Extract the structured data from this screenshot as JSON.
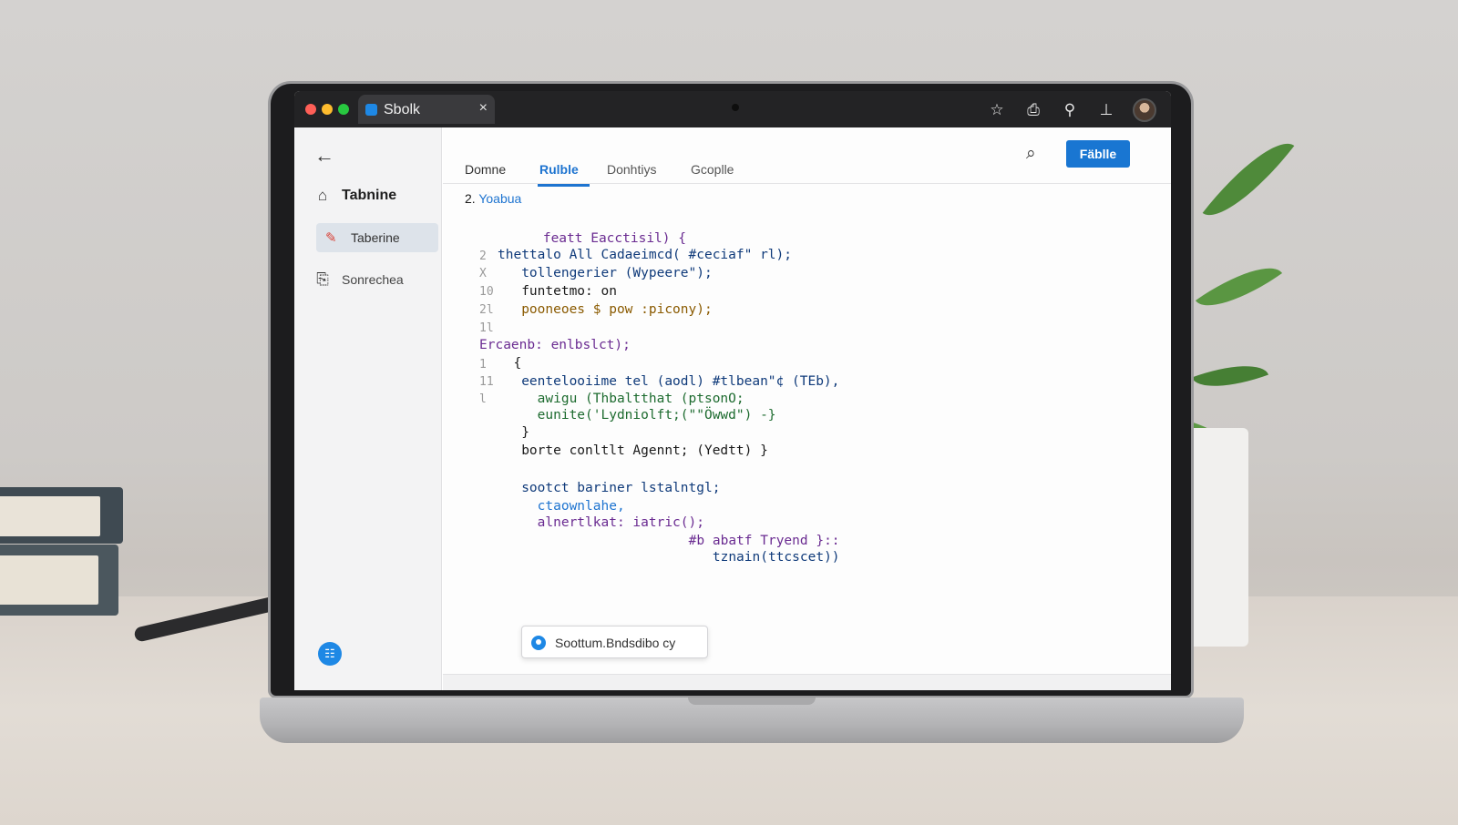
{
  "browser": {
    "tab_title": "Sbolk",
    "tab_close": "×"
  },
  "sidebar": {
    "back_icon": "←",
    "items": [
      {
        "label": "Tabnine",
        "icon": "home-icon"
      },
      {
        "label": "Taberine",
        "icon": "pencil-icon"
      },
      {
        "label": "Sonrechea",
        "icon": "export-icon"
      }
    ]
  },
  "main": {
    "tabs": [
      "Domne",
      "Rulble",
      "Donhtiys",
      "Gcoplle"
    ],
    "active_tab": "Rulble",
    "action_button": "Fäblle",
    "file_prefix": "2.",
    "file_name": "Yoabua"
  },
  "code": {
    "lines": [
      {
        "ln": "",
        "text": "featt Eacctisil) {"
      },
      {
        "ln": "2",
        "text": "thettalo All Cadaeimcd( #ceciaf\" rl);"
      },
      {
        "ln": "X",
        "text": "   tollengerier (Wypeere\");"
      },
      {
        "ln": "10",
        "text": "   funtetmo: on"
      },
      {
        "ln": "2l",
        "text": "   pooneoes $ pow :picony);"
      },
      {
        "ln": "1l",
        "text": ""
      },
      {
        "ln": "",
        "text": "Ercaenb: enlbslct);"
      },
      {
        "ln": "1",
        "text": "  {"
      },
      {
        "ln": "11",
        "text": "   eentelooiime tel (aodl) #tlbean\"¢ (TEb),"
      },
      {
        "ln": "l",
        "text": "     awigu (Thbaltthat (ptsonO;"
      },
      {
        "ln": "",
        "text": "     eunite('Lydniolft;(\"\"Öwwd\") -}"
      },
      {
        "ln": "",
        "text": "   }"
      },
      {
        "ln": "",
        "text": "   borte conltlt Agennt; (Yedtt) }"
      },
      {
        "ln": "",
        "text": ""
      },
      {
        "ln": "",
        "text": "   sootct bariner lstalntgl;"
      },
      {
        "ln": "",
        "text": "     ctaownlahe,"
      },
      {
        "ln": "",
        "text": "     alnertlkat: iatric();"
      },
      {
        "ln": "",
        "text": "                #b abatf Tryend }::"
      },
      {
        "ln": "",
        "text": "                   tznain(ttcscet))"
      }
    ]
  },
  "popup": {
    "text": "Soottum.Bndsdibo cy",
    "icon": "refresh-icon"
  },
  "colors": {
    "accent": "#1976d2",
    "tab_active": "#1e74d0",
    "topbar": "#232325"
  }
}
